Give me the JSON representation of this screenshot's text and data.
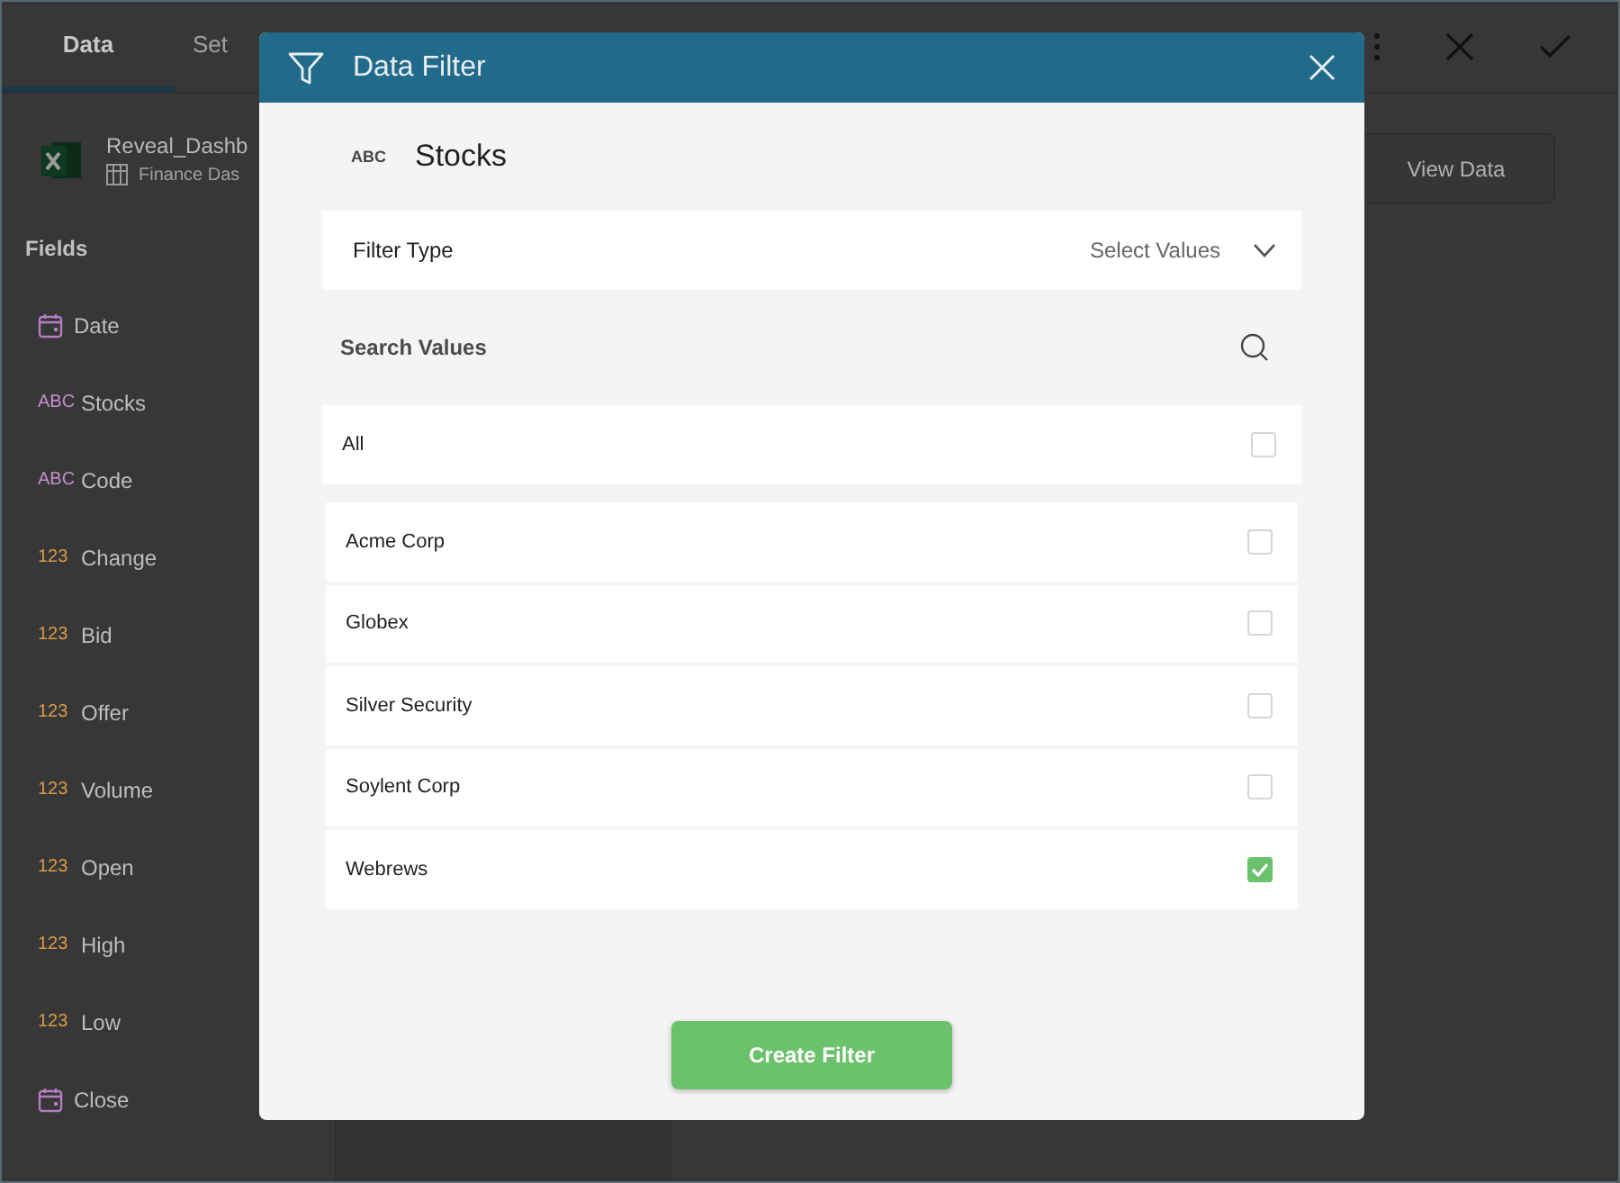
{
  "tabs": [
    {
      "label": "Data",
      "selected": true
    },
    {
      "label": "Set",
      "selected": false
    }
  ],
  "source": {
    "name": "Reveal_Dashb",
    "sheet": "Finance Das"
  },
  "fields_heading": "Fields",
  "fields": [
    {
      "kind": "date",
      "name": "Date"
    },
    {
      "kind": "text",
      "badge": "ABC",
      "name": "Stocks"
    },
    {
      "kind": "text",
      "badge": "ABC",
      "name": "Code"
    },
    {
      "kind": "number",
      "badge": "123",
      "name": "Change"
    },
    {
      "kind": "number",
      "badge": "123",
      "name": "Bid"
    },
    {
      "kind": "number",
      "badge": "123",
      "name": "Offer"
    },
    {
      "kind": "number",
      "badge": "123",
      "name": "Volume"
    },
    {
      "kind": "number",
      "badge": "123",
      "name": "Open"
    },
    {
      "kind": "number",
      "badge": "123",
      "name": "High"
    },
    {
      "kind": "number",
      "badge": "123",
      "name": "Low"
    },
    {
      "kind": "date",
      "name": "Close"
    }
  ],
  "view_data_button": "View Data",
  "dialog": {
    "title": "Data Filter",
    "field": {
      "badge": "ABC",
      "name": "Stocks"
    },
    "filter_type": {
      "label": "Filter Type",
      "value": "Select Values"
    },
    "search": {
      "placeholder": "Search Values"
    },
    "all": {
      "label": "All",
      "checked": false
    },
    "values": [
      {
        "label": "Acme Corp",
        "checked": false
      },
      {
        "label": "Globex",
        "checked": false
      },
      {
        "label": "Silver Security",
        "checked": false
      },
      {
        "label": "Soylent Corp",
        "checked": false
      },
      {
        "label": "Webrews",
        "checked": true
      }
    ],
    "create_button": "Create Filter"
  }
}
